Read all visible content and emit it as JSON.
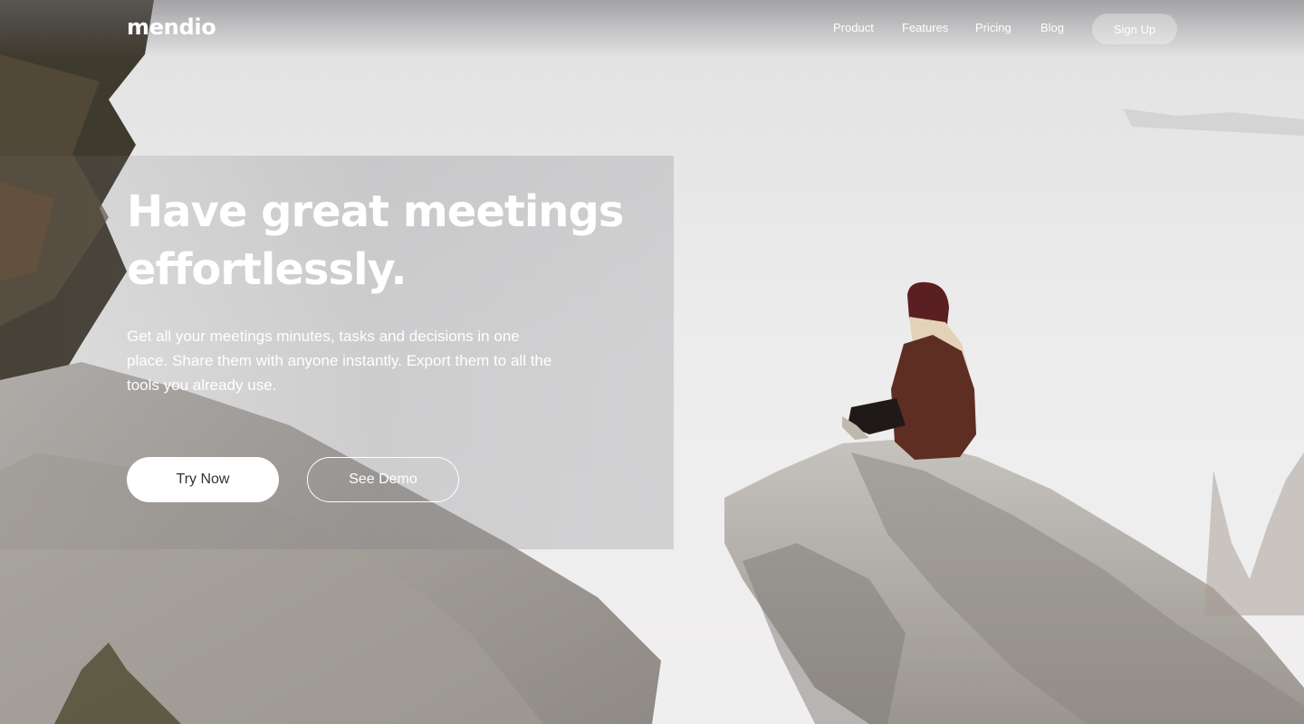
{
  "brand": {
    "logo": "mendio"
  },
  "nav": {
    "links": [
      "Product",
      "Features",
      "Pricing",
      "Blog"
    ],
    "signup_label": "Sign Up"
  },
  "hero": {
    "headline": "Have great meetings effortlessly.",
    "subtext": "Get all your meetings minutes, tasks and decisions in one place. Share them with anyone instantly. Export them to all the tools you already use.",
    "primary_cta": "Try Now",
    "secondary_cta": "See Demo"
  },
  "colors": {
    "text_on_image": "#ffffff",
    "primary_button_bg": "#ffffff",
    "primary_button_text": "#333333"
  }
}
